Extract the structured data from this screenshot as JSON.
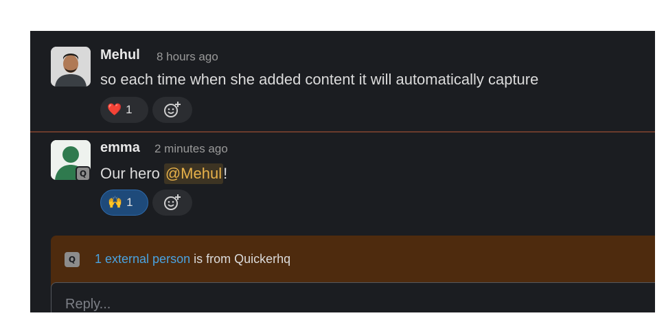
{
  "messages": [
    {
      "author": "Mehul",
      "time": "8 hours ago",
      "text": "so each time when she added content it will automatically capture",
      "reaction": {
        "emoji": "❤️",
        "count": "1"
      }
    },
    {
      "author": "emma",
      "time": "2 minutes ago",
      "text_before": "Our hero",
      "mention": "@Mehul",
      "text_after": "!",
      "reaction": {
        "emoji": "🙌",
        "count": "1"
      },
      "external_badge": "Q"
    }
  ],
  "external_notice": {
    "icon_letter": "Q",
    "link_text": "1 external person",
    "suffix": " is from Quickerhq"
  },
  "composer": {
    "placeholder": "Reply..."
  },
  "colors": {
    "background": "#1b1d21",
    "mention": "#e8b24a",
    "link": "#4aa3e0",
    "banner": "#4e2b0e"
  }
}
